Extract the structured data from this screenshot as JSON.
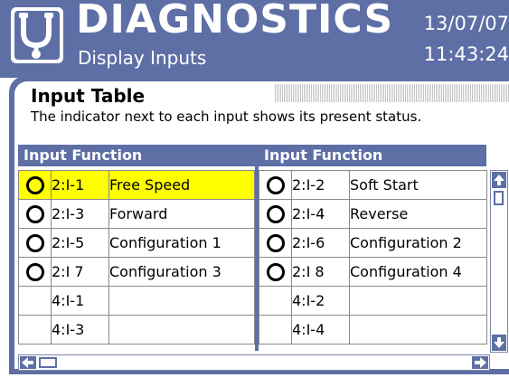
{
  "header": {
    "title": "DIAGNOSTICS",
    "subtitle": "Display Inputs",
    "date": "13/07/07",
    "time": "11:43:24",
    "logo_icon": "stethoscope-icon"
  },
  "panel": {
    "heading": "Input Table",
    "description": "The indicator next to each input shows its present status."
  },
  "tables": {
    "left": {
      "header": "Input Function",
      "rows": [
        {
          "indicator": true,
          "address": "2:I-1",
          "function": "Free Speed",
          "selected": true
        },
        {
          "indicator": true,
          "address": "2:I-3",
          "function": "Forward",
          "selected": false
        },
        {
          "indicator": true,
          "address": "2:I-5",
          "function": "Configuration 1",
          "selected": false
        },
        {
          "indicator": true,
          "address": "2:I 7",
          "function": "Configuration 3",
          "selected": false
        },
        {
          "indicator": false,
          "address": "4:I-1",
          "function": "",
          "selected": false
        },
        {
          "indicator": false,
          "address": "4:I-3",
          "function": "",
          "selected": false
        }
      ]
    },
    "right": {
      "header": "Input Function",
      "rows": [
        {
          "indicator": true,
          "address": "2:I-2",
          "function": "Soft Start",
          "selected": false
        },
        {
          "indicator": true,
          "address": "2:I-4",
          "function": "Reverse",
          "selected": false
        },
        {
          "indicator": true,
          "address": "2:I-6",
          "function": "Configuration 2",
          "selected": false
        },
        {
          "indicator": true,
          "address": "2:I 8",
          "function": "Configuration 4",
          "selected": false
        },
        {
          "indicator": false,
          "address": "4:I-2",
          "function": "",
          "selected": false
        },
        {
          "indicator": false,
          "address": "4:I-4",
          "function": "",
          "selected": false
        }
      ]
    }
  },
  "colors": {
    "header_bg": "#5e6fa6",
    "selected_row": "#ffff00"
  }
}
